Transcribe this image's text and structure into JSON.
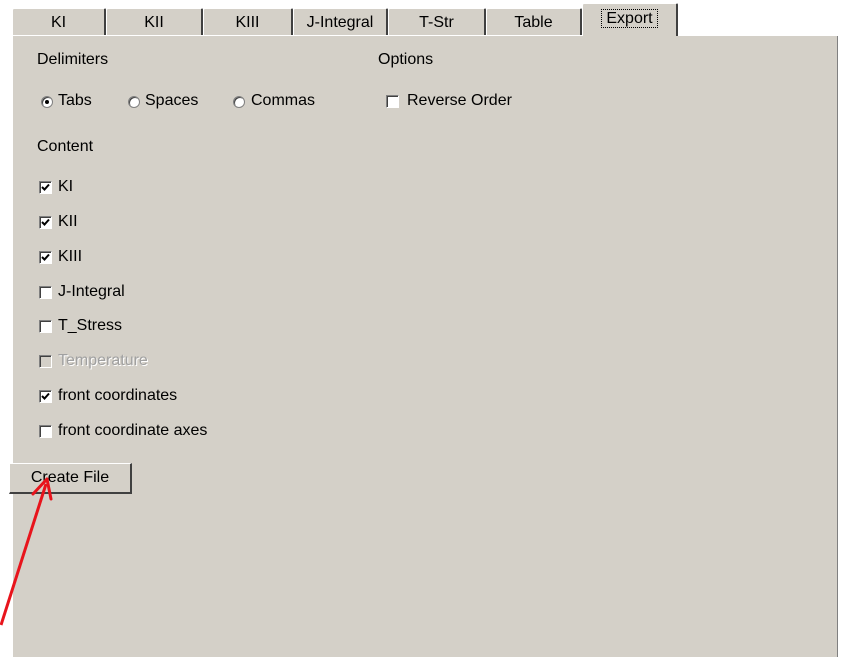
{
  "tabs": [
    {
      "label": "KI"
    },
    {
      "label": "KII"
    },
    {
      "label": "KIII"
    },
    {
      "label": "J-Integral"
    },
    {
      "label": "T-Str"
    },
    {
      "label": "Table"
    },
    {
      "label": "Export",
      "active": true
    }
  ],
  "delimiters": {
    "heading": "Delimiters",
    "options": [
      {
        "label": "Tabs",
        "selected": true
      },
      {
        "label": "Spaces",
        "selected": false
      },
      {
        "label": "Commas",
        "selected": false
      }
    ]
  },
  "options_section": {
    "heading": "Options",
    "reverse_order": {
      "label": "Reverse Order",
      "checked": false
    }
  },
  "content": {
    "heading": "Content",
    "items": [
      {
        "label": "KI",
        "checked": true,
        "enabled": true
      },
      {
        "label": "KII",
        "checked": true,
        "enabled": true
      },
      {
        "label": "KIII",
        "checked": true,
        "enabled": true
      },
      {
        "label": "J-Integral",
        "checked": false,
        "enabled": true
      },
      {
        "label": "T_Stress",
        "checked": false,
        "enabled": true
      },
      {
        "label": "Temperature",
        "checked": false,
        "enabled": false
      },
      {
        "label": "front coordinates",
        "checked": true,
        "enabled": true
      },
      {
        "label": "front coordinate axes",
        "checked": false,
        "enabled": true
      }
    ]
  },
  "create_file_button": {
    "label": "Create File"
  },
  "colors": {
    "panel": "#d4d0c8",
    "annotation_arrow": "#e8141c"
  }
}
